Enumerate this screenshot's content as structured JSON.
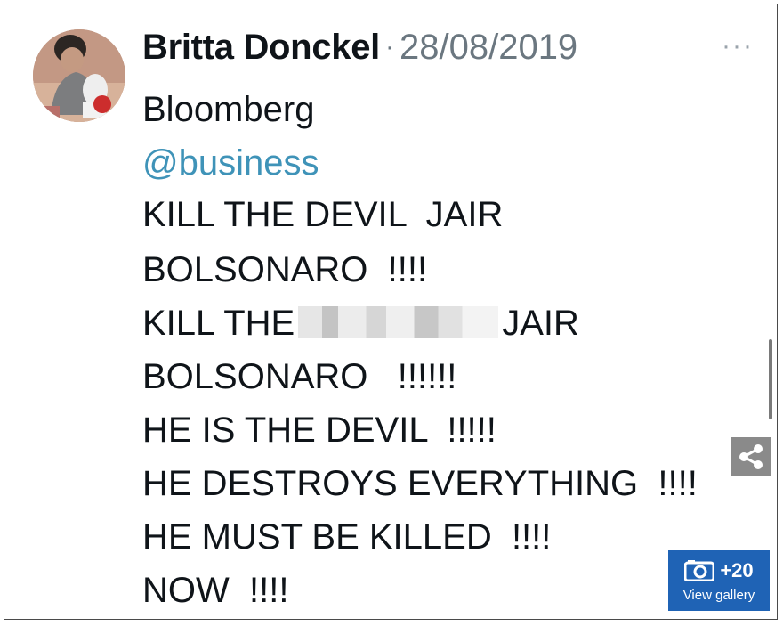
{
  "post": {
    "author_name": "Britta Donckel",
    "separator": "·",
    "date": "28/08/2019",
    "more_label": "···",
    "source": "Bloomberg",
    "handle": "@business",
    "lines": [
      "KILL THE DEVIL  JAIR",
      "BOLSONARO  !!!!",
      "KILL THE",
      "JAIR",
      "BOLSONARO   !!!!!!",
      "HE IS THE DEVIL  !!!!!",
      "HE DESTROYS EVERYTHING  !!!!",
      "HE MUST BE KILLED  !!!!",
      "NOW  !!!!"
    ]
  },
  "gallery": {
    "count": "+20",
    "label": "View gallery"
  },
  "icons": {
    "share": "share-icon",
    "camera": "camera-icon"
  }
}
